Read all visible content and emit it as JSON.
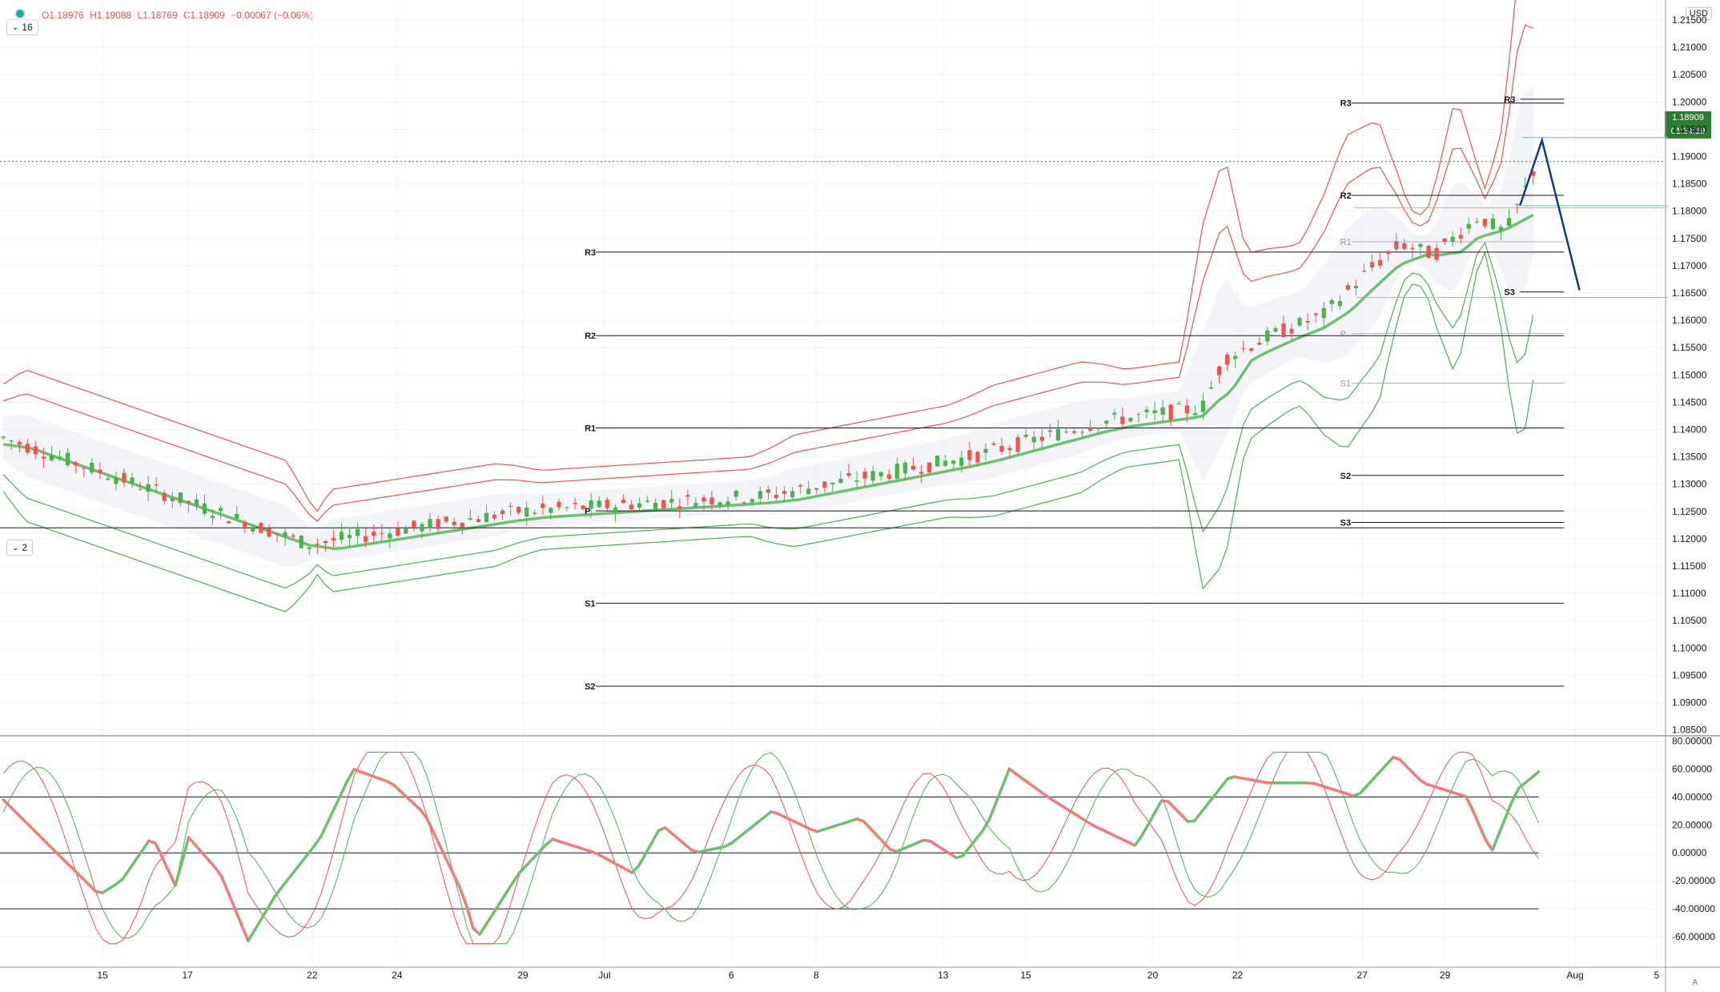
{
  "header": {
    "open": "O1.18976",
    "high": "H1.19088",
    "low": "L1.18769",
    "close": "C1.18909",
    "change": "−0.00067 (−0.06%)"
  },
  "main_pane_badge": "16",
  "osc_pane_badge": "2",
  "currency": "USD",
  "last_price_label": "1.18909",
  "countdown_label": "01:34:19",
  "auto_scale_button": "A",
  "colors": {
    "bull": "#4caf50",
    "bear": "#ef5350",
    "bb_upper": "#ef5350",
    "bb_lower": "#4caf50",
    "pivot": "#131722",
    "forecast": "#0d3b8c",
    "level_orange": "#f7a440",
    "level_teal": "#80d8b8"
  },
  "chart_data": [
    {
      "type": "candlestick",
      "symbol_currency": "USD",
      "y_ticks": [
        "1.21500",
        "1.21000",
        "1.20500",
        "1.20000",
        "1.19500",
        "1.19000",
        "1.18500",
        "1.18000",
        "1.17500",
        "1.17000",
        "1.16500",
        "1.16000",
        "1.15500",
        "1.15000",
        "1.14500",
        "1.14000",
        "1.13500",
        "1.13000",
        "1.12500",
        "1.12000",
        "1.11500",
        "1.11000",
        "1.10500",
        "1.10000",
        "1.09500",
        "1.09000",
        "1.08500"
      ],
      "x_ticks": [
        "15",
        "17",
        "22",
        "24",
        "29",
        "Jul",
        "6",
        "8",
        "13",
        "15",
        "20",
        "22",
        "27",
        "29",
        "Aug",
        "5"
      ],
      "ylim": [
        1.0845,
        1.2175
      ],
      "last_price": 1.18909,
      "trend_anchors": [
        {
          "x": 3,
          "y": 1.1385
        },
        {
          "x": 280,
          "y": 1.119
        },
        {
          "x": 470,
          "y": 1.125
        },
        {
          "x": 700,
          "y": 1.128
        },
        {
          "x": 880,
          "y": 1.135
        },
        {
          "x": 1000,
          "y": 1.1415
        },
        {
          "x": 1090,
          "y": 1.144
        },
        {
          "x": 1110,
          "y": 1.153
        },
        {
          "x": 1150,
          "y": 1.157
        },
        {
          "x": 1200,
          "y": 1.161
        },
        {
          "x": 1240,
          "y": 1.169
        },
        {
          "x": 1270,
          "y": 1.174
        },
        {
          "x": 1300,
          "y": 1.172
        },
        {
          "x": 1340,
          "y": 1.179
        },
        {
          "x": 1365,
          "y": 1.176
        },
        {
          "x": 1395,
          "y": 1.1895
        }
      ],
      "pivot_sets": [
        {
          "x1": 530,
          "x2": 1418,
          "levels": [
            {
              "label": "R3",
              "y": 1.1725
            },
            {
              "label": "R2",
              "y": 1.1572
            },
            {
              "label": "R1",
              "y": 1.1403
            },
            {
              "label": "P",
              "y": 1.1251
            },
            {
              "label": "S1",
              "y": 1.1082
            },
            {
              "label": "S2",
              "y": 1.093
            }
          ]
        },
        {
          "x1": 0,
          "x2": 1418,
          "levels": [
            {
              "label": "",
              "y": 1.122
            }
          ]
        },
        {
          "x1": 1215,
          "x2": 1418,
          "levels": [
            {
              "label": "R3",
              "y": 1.1998
            },
            {
              "label": "R2",
              "y": 1.1829
            },
            {
              "label": "R1",
              "y": 1.1744,
              "dim": true
            },
            {
              "label": "P",
              "y": 1.1576,
              "dim": true
            },
            {
              "label": "S1",
              "y": 1.1485,
              "dim": true
            },
            {
              "label": "S2",
              "y": 1.1316
            },
            {
              "label": "S3",
              "y": 1.123
            }
          ]
        },
        {
          "x1": 1368,
          "x2": 1418,
          "levels": [
            {
              "label": "R3",
              "y": 1.2005
            },
            {
              "label": "S3",
              "y": 1.1652
            }
          ]
        }
      ],
      "orange_levels": [
        {
          "x1": 1228,
          "x2": 1512,
          "y": 1.1806
        },
        {
          "x1": 1230,
          "x2": 1512,
          "y": 1.1642
        }
      ],
      "teal_levels": [
        {
          "x1": 1380,
          "x2": 1512,
          "y": 1.1935
        },
        {
          "x1": 1380,
          "x2": 1512,
          "y": 1.181
        }
      ],
      "forecast_path": [
        {
          "x": 1378,
          "y": 1.181
        },
        {
          "x": 1398,
          "y": 1.193
        },
        {
          "x": 1432,
          "y": 1.1655
        }
      ]
    },
    {
      "type": "line",
      "name": "oscillator",
      "y_ticks": [
        "80.00000",
        "60.00000",
        "40.00000",
        "20.00000",
        "0.00000",
        "-20.00000",
        "-40.00000",
        "-60.00000"
      ],
      "ylim": [
        -80,
        82
      ],
      "levels": [
        40,
        0,
        -40
      ],
      "main_anchors": [
        {
          "x": 3,
          "y": 38
        },
        {
          "x": 45,
          "y": 5
        },
        {
          "x": 90,
          "y": -30
        },
        {
          "x": 110,
          "y": -20
        },
        {
          "x": 138,
          "y": 12
        },
        {
          "x": 160,
          "y": -25
        },
        {
          "x": 170,
          "y": 12
        },
        {
          "x": 200,
          "y": -15
        },
        {
          "x": 225,
          "y": -63
        },
        {
          "x": 250,
          "y": -30
        },
        {
          "x": 290,
          "y": 10
        },
        {
          "x": 320,
          "y": 60
        },
        {
          "x": 355,
          "y": 50
        },
        {
          "x": 385,
          "y": 28
        },
        {
          "x": 420,
          "y": -30
        },
        {
          "x": 432,
          "y": -62
        },
        {
          "x": 470,
          "y": -15
        },
        {
          "x": 500,
          "y": 10
        },
        {
          "x": 540,
          "y": 0
        },
        {
          "x": 575,
          "y": -15
        },
        {
          "x": 600,
          "y": 20
        },
        {
          "x": 630,
          "y": 0
        },
        {
          "x": 660,
          "y": 5
        },
        {
          "x": 700,
          "y": 30
        },
        {
          "x": 740,
          "y": 15
        },
        {
          "x": 780,
          "y": 25
        },
        {
          "x": 810,
          "y": 0
        },
        {
          "x": 840,
          "y": 10
        },
        {
          "x": 870,
          "y": -5
        },
        {
          "x": 895,
          "y": 20
        },
        {
          "x": 915,
          "y": 60
        },
        {
          "x": 950,
          "y": 40
        },
        {
          "x": 990,
          "y": 20
        },
        {
          "x": 1030,
          "y": 5
        },
        {
          "x": 1055,
          "y": 40
        },
        {
          "x": 1080,
          "y": 20
        },
        {
          "x": 1115,
          "y": 55
        },
        {
          "x": 1150,
          "y": 50
        },
        {
          "x": 1190,
          "y": 50
        },
        {
          "x": 1230,
          "y": 40
        },
        {
          "x": 1265,
          "y": 70
        },
        {
          "x": 1290,
          "y": 50
        },
        {
          "x": 1330,
          "y": 40
        },
        {
          "x": 1352,
          "y": 0
        },
        {
          "x": 1375,
          "y": 45
        },
        {
          "x": 1395,
          "y": 58
        }
      ]
    }
  ]
}
